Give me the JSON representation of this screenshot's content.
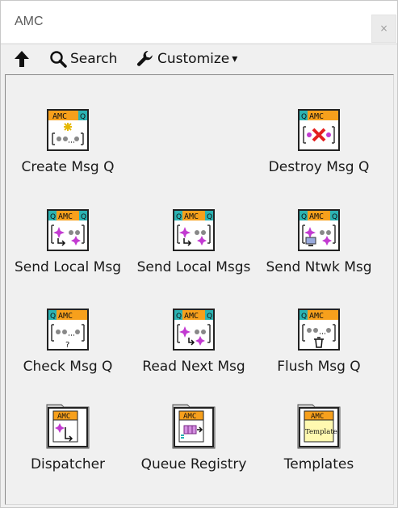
{
  "window": {
    "title": "AMC",
    "close_glyph": "×"
  },
  "toolbar": {
    "up_icon": "up-arrow-icon",
    "search_label": "Search",
    "search_icon": "magnifier-icon",
    "customize_label": "Customize",
    "customize_icon": "wrench-icon",
    "customize_caret": "▾"
  },
  "palette": {
    "items": [
      {
        "label": "Create Msg Q",
        "icon": "create-msg-q-icon",
        "header": "AMC"
      },
      {
        "label": "Destroy Msg Q",
        "icon": "destroy-msg-q-icon",
        "header": "AMC"
      },
      {
        "label": "Send Local Msg",
        "icon": "send-local-msg-icon",
        "header": "AMC"
      },
      {
        "label": "Send Local Msgs",
        "icon": "send-local-msgs-icon",
        "header": "AMC"
      },
      {
        "label": "Send Ntwk Msg",
        "icon": "send-ntwk-msg-icon",
        "header": "AMC"
      },
      {
        "label": "Check Msg Q",
        "icon": "check-msg-q-icon",
        "header": "AMC"
      },
      {
        "label": "Read Next Msg",
        "icon": "read-next-msg-icon",
        "header": "AMC"
      },
      {
        "label": "Flush Msg Q",
        "icon": "flush-msg-q-icon",
        "header": "AMC"
      },
      {
        "label": "Dispatcher",
        "icon": "dispatcher-folder-icon",
        "header": "AMC"
      },
      {
        "label": "Queue Registry",
        "icon": "queue-registry-folder-icon",
        "header": "AMC"
      },
      {
        "label": "Templates",
        "icon": "templates-folder-icon",
        "header": "Template"
      }
    ]
  },
  "colors": {
    "amc_header": "#f7a01c",
    "q_badge": "#2bb3b3",
    "accent_magenta": "#c23ad1",
    "destroy_red": "#e32020",
    "template_yellow": "#fff9b0"
  }
}
